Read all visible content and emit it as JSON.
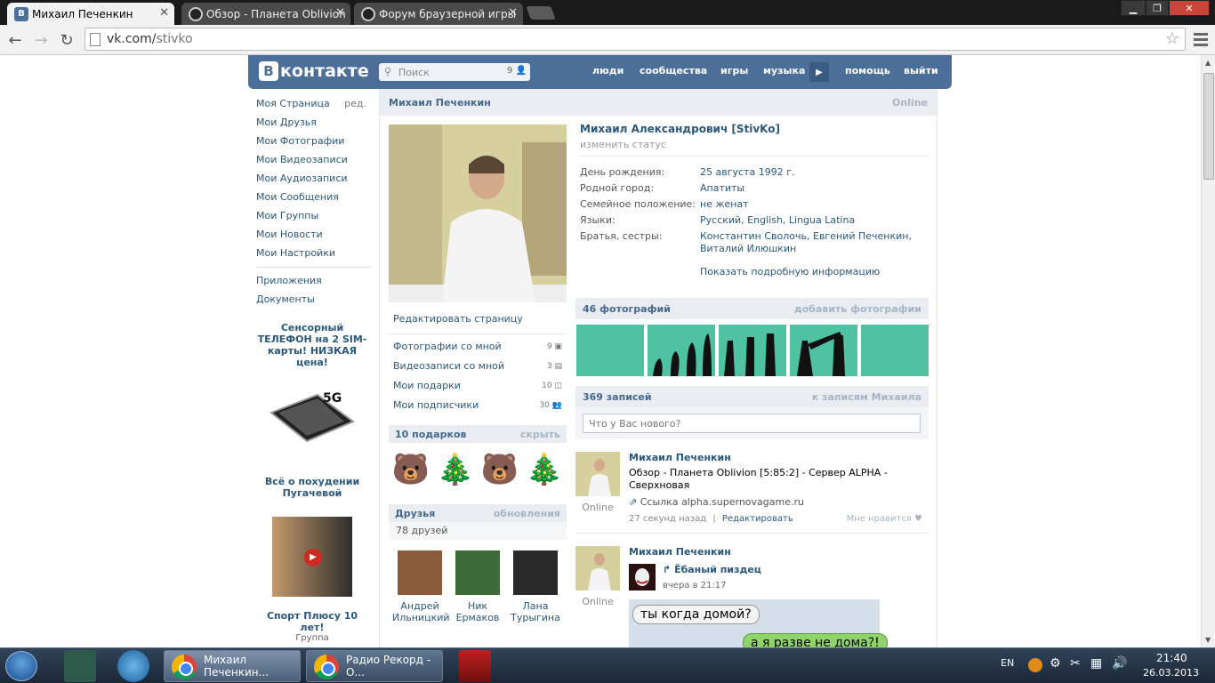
{
  "browser": {
    "tabs": [
      {
        "title": "Михаил Печенкин",
        "favicon_color": "#4b6f99",
        "active": true
      },
      {
        "title": "Обзор - Планета Oblivion",
        "favicon_color": "#222222",
        "active": false
      },
      {
        "title": "Форум браузерной игры",
        "favicon_color": "#222222",
        "active": false
      }
    ],
    "url_host": "vk.com/",
    "url_path": "stivko"
  },
  "vk": {
    "logo_text": "контакте",
    "logo_letter": "B",
    "search_placeholder": "Поиск",
    "search_count": "9",
    "nav": [
      "люди",
      "сообщества",
      "игры",
      "музыка",
      "помощь",
      "выйти"
    ]
  },
  "left_menu": {
    "items": [
      "Моя Страница",
      "Мои Друзья",
      "Мои Фотографии",
      "Мои Видеозаписи",
      "Мои Аудиозаписи",
      "Мои Сообщения",
      "Мои Группы",
      "Мои Новости",
      "Мои Настройки"
    ],
    "edit_label": "ред.",
    "extra": [
      "Приложения",
      "Документы"
    ],
    "ads": [
      {
        "title": "Сенсорный ТЕЛЕФОН на 2 SIM-карты! НИЗКАЯ цена!",
        "badge": "5G"
      },
      {
        "title": "Всё о похудении Пугачевой"
      },
      {
        "title": "Спорт Плюсу 10 лет!",
        "sub": "Группа"
      }
    ]
  },
  "profile": {
    "header_name": "Михаил Печенкин",
    "header_status": "Online",
    "full_name": "Михаил Александрович [StivKo]",
    "change_status": "изменить статус",
    "fields": [
      {
        "k": "День рождения:",
        "v": "25 августа 1992 г."
      },
      {
        "k": "Родной город:",
        "v": "Апатиты"
      },
      {
        "k": "Семейное положение:",
        "v": "не женат"
      },
      {
        "k": "Языки:",
        "v": "Русский, English, Lingua Latina"
      },
      {
        "k": "Братья, сестры:",
        "v": "Константин Сволочь, Евгений Печенкин, Виталий Илюшкин"
      }
    ],
    "show_more": "Показать подробную информацию",
    "edit_page": "Редактировать страницу",
    "links": [
      {
        "label": "Фотографии со мной",
        "count": "9"
      },
      {
        "label": "Видеозаписи со мной",
        "count": "3"
      },
      {
        "label": "Мои подарки",
        "count": "10"
      },
      {
        "label": "Мои подписчики",
        "count": "30"
      }
    ],
    "gifts_title": "10 подарков",
    "gifts_hide": "скрыть",
    "friends_title": "Друзья",
    "friends_updates": "обновления",
    "friends_count": "78 друзей",
    "friends": [
      {
        "first": "Андрей",
        "last": "Ильницкий"
      },
      {
        "first": "Ник",
        "last": "Ермаков"
      },
      {
        "first": "Лана",
        "last": "Турыгина"
      }
    ],
    "photos_title": "46 фотографий",
    "photos_add": "добавить фотографии",
    "posts_title": "369 записей",
    "posts_link": "к записям Михаила",
    "post_placeholder": "Что у Вас нового?"
  },
  "posts": [
    {
      "author": "Михаил Печенкин",
      "text": "Обзор - Планета Oblivion [5:85:2] - Сервер ALPHA - Сверхновая",
      "link_prefix": "Ссылка",
      "link": "alpha.supernovagame.ru",
      "time": "27 секунд назад",
      "sep": "|",
      "edit": "Редактировать",
      "like": "Мне нравится",
      "online": "Online"
    },
    {
      "author": "Михаил Печенкин",
      "repost_title": "Ёбаный пиздец",
      "time": "вчера в 21:17",
      "online": "Online",
      "bubble1": "ты когда домой?",
      "bubble2": "а я разве не дома?!"
    }
  ],
  "taskbar": {
    "tasks": [
      "Михаил Печенкин...",
      "Радио Рекорд - О..."
    ],
    "lang": "EN",
    "time": "21:40",
    "date": "26.03.2013"
  }
}
